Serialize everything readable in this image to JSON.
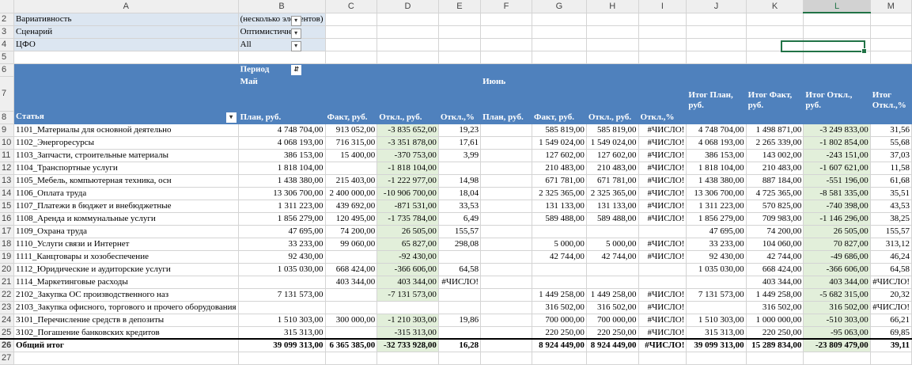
{
  "columns": [
    "A",
    "B",
    "C",
    "D",
    "E",
    "F",
    "G",
    "H",
    "I",
    "J",
    "K",
    "L",
    "M"
  ],
  "selected_column": "L",
  "filters": [
    {
      "row": "2",
      "label": "Вариативность",
      "value": "(несколько элементов)"
    },
    {
      "row": "3",
      "label": "Сценарий",
      "value": "Оптимистичн"
    },
    {
      "row": "4",
      "label": "ЦФО",
      "value": "All"
    }
  ],
  "row5": "5",
  "header": {
    "row6": "6",
    "row7": "7",
    "row8": "8",
    "period_label": "Период",
    "may": "Май",
    "june": "Июнь",
    "total_plan": "Итог План, руб.",
    "total_fact": "Итог Факт, руб.",
    "total_dev": "Итог Откл., руб.",
    "total_dev_pct": "Итог Откл.,%",
    "article": "Статья",
    "plan": "План, руб.",
    "fact": "Факт, руб.",
    "dev": "Откл., руб.",
    "dev_pct": "Откл.,%",
    "plan2": "План, руб.",
    "fact2": "Факт, руб.",
    "dev2": "Откл., руб.",
    "dev_pct2": "Откл.,%"
  },
  "rows": [
    {
      "n": "9",
      "a": "1101_Материалы для основной деятельно",
      "b": "4 748 704,00",
      "c": "913 052,00",
      "d": "-3 835 652,00",
      "e": "19,23",
      "f": "",
      "g": "585 819,00",
      "h": "585 819,00",
      "i": "#ЧИСЛО!",
      "j": "4 748 704,00",
      "k": "1 498 871,00",
      "l": "-3 249 833,00",
      "m": "31,56"
    },
    {
      "n": "10",
      "a": "1102_Энергоресурсы",
      "b": "4 068 193,00",
      "c": "716 315,00",
      "d": "-3 351 878,00",
      "e": "17,61",
      "f": "",
      "g": "1 549 024,00",
      "h": "1 549 024,00",
      "i": "#ЧИСЛО!",
      "j": "4 068 193,00",
      "k": "2 265 339,00",
      "l": "-1 802 854,00",
      "m": "55,68"
    },
    {
      "n": "11",
      "a": "1103_Запчасти, строительные материалы",
      "b": "386 153,00",
      "c": "15 400,00",
      "d": "-370 753,00",
      "e": "3,99",
      "f": "",
      "g": "127 602,00",
      "h": "127 602,00",
      "i": "#ЧИСЛО!",
      "j": "386 153,00",
      "k": "143 002,00",
      "l": "-243 151,00",
      "m": "37,03"
    },
    {
      "n": "12",
      "a": "1104_Транспортные услуги",
      "b": "1 818 104,00",
      "c": "",
      "d": "-1 818 104,00",
      "e": "",
      "f": "",
      "g": "210 483,00",
      "h": "210 483,00",
      "i": "#ЧИСЛО!",
      "j": "1 818 104,00",
      "k": "210 483,00",
      "l": "-1 607 621,00",
      "m": "11,58"
    },
    {
      "n": "13",
      "a": "1105_Мебель, компьютерная техника, осн",
      "b": "1 438 380,00",
      "c": "215 403,00",
      "d": "-1 222 977,00",
      "e": "14,98",
      "f": "",
      "g": "671 781,00",
      "h": "671 781,00",
      "i": "#ЧИСЛО!",
      "j": "1 438 380,00",
      "k": "887 184,00",
      "l": "-551 196,00",
      "m": "61,68"
    },
    {
      "n": "14",
      "a": "1106_Оплата труда",
      "b": "13 306 700,00",
      "c": "2 400 000,00",
      "d": "-10 906 700,00",
      "e": "18,04",
      "f": "",
      "g": "2 325 365,00",
      "h": "2 325 365,00",
      "i": "#ЧИСЛО!",
      "j": "13 306 700,00",
      "k": "4 725 365,00",
      "l": "-8 581 335,00",
      "m": "35,51"
    },
    {
      "n": "15",
      "a": "1107_Платежи в бюджет и внебюджетные",
      "b": "1 311 223,00",
      "c": "439 692,00",
      "d": "-871 531,00",
      "e": "33,53",
      "f": "",
      "g": "131 133,00",
      "h": "131 133,00",
      "i": "#ЧИСЛО!",
      "j": "1 311 223,00",
      "k": "570 825,00",
      "l": "-740 398,00",
      "m": "43,53"
    },
    {
      "n": "16",
      "a": "1108_Аренда и коммунальные услуги",
      "b": "1 856 279,00",
      "c": "120 495,00",
      "d": "-1 735 784,00",
      "e": "6,49",
      "f": "",
      "g": "589 488,00",
      "h": "589 488,00",
      "i": "#ЧИСЛО!",
      "j": "1 856 279,00",
      "k": "709 983,00",
      "l": "-1 146 296,00",
      "m": "38,25"
    },
    {
      "n": "17",
      "a": "1109_Охрана труда",
      "b": "47 695,00",
      "c": "74 200,00",
      "d": "26 505,00",
      "e": "155,57",
      "f": "",
      "g": "",
      "h": "",
      "i": "",
      "j": "47 695,00",
      "k": "74 200,00",
      "l": "26 505,00",
      "m": "155,57"
    },
    {
      "n": "18",
      "a": "1110_Услуги связи и Интернет",
      "b": "33 233,00",
      "c": "99 060,00",
      "d": "65 827,00",
      "e": "298,08",
      "f": "",
      "g": "5 000,00",
      "h": "5 000,00",
      "i": "#ЧИСЛО!",
      "j": "33 233,00",
      "k": "104 060,00",
      "l": "70 827,00",
      "m": "313,12"
    },
    {
      "n": "19",
      "a": "1111_Канцтовары и хозобеспечение",
      "b": "92 430,00",
      "c": "",
      "d": "-92 430,00",
      "e": "",
      "f": "",
      "g": "42 744,00",
      "h": "42 744,00",
      "i": "#ЧИСЛО!",
      "j": "92 430,00",
      "k": "42 744,00",
      "l": "-49 686,00",
      "m": "46,24"
    },
    {
      "n": "20",
      "a": "1112_Юридические и аудиторские услуги",
      "b": "1 035 030,00",
      "c": "668 424,00",
      "d": "-366 606,00",
      "e": "64,58",
      "f": "",
      "g": "",
      "h": "",
      "i": "",
      "j": "1 035 030,00",
      "k": "668 424,00",
      "l": "-366 606,00",
      "m": "64,58"
    },
    {
      "n": "21",
      "a": "1114_Маркетинговые расходы",
      "b": "",
      "c": "403 344,00",
      "d": "403 344,00",
      "e": "#ЧИСЛО!",
      "f": "",
      "g": "",
      "h": "",
      "i": "",
      "j": "",
      "k": "403 344,00",
      "l": "403 344,00",
      "m": "#ЧИСЛО!"
    },
    {
      "n": "22",
      "a": "2102_Закупка ОС производственного наз",
      "b": "7 131 573,00",
      "c": "",
      "d": "-7 131 573,00",
      "e": "",
      "f": "",
      "g": "1 449 258,00",
      "h": "1 449 258,00",
      "i": "#ЧИСЛО!",
      "j": "7 131 573,00",
      "k": "1 449 258,00",
      "l": "-5 682 315,00",
      "m": "20,32"
    },
    {
      "n": "23",
      "a": "2103_Закупка офисного, торгового и прочего оборудования",
      "b": "",
      "c": "",
      "d": "",
      "e": "",
      "f": "",
      "g": "316 502,00",
      "h": "316 502,00",
      "i": "#ЧИСЛО!",
      "j": "",
      "k": "316 502,00",
      "l": "316 502,00",
      "m": "#ЧИСЛО!"
    },
    {
      "n": "24",
      "a": "3101_Перечисление средств в депозиты",
      "b": "1 510 303,00",
      "c": "300 000,00",
      "d": "-1 210 303,00",
      "e": "19,86",
      "f": "",
      "g": "700 000,00",
      "h": "700 000,00",
      "i": "#ЧИСЛО!",
      "j": "1 510 303,00",
      "k": "1 000 000,00",
      "l": "-510 303,00",
      "m": "66,21"
    },
    {
      "n": "25",
      "a": "3102_Погашение банковских кредитов",
      "b": "315 313,00",
      "c": "",
      "d": "-315 313,00",
      "e": "",
      "f": "",
      "g": "220 250,00",
      "h": "220 250,00",
      "i": "#ЧИСЛО!",
      "j": "315 313,00",
      "k": "220 250,00",
      "l": "-95 063,00",
      "m": "69,85"
    }
  ],
  "total": {
    "n": "26",
    "a": "Общий итог",
    "b": "39 099 313,00",
    "c": "6 365 385,00",
    "d": "-32 733 928,00",
    "e": "16,28",
    "f": "",
    "g": "8 924 449,00",
    "h": "8 924 449,00",
    "i": "#ЧИСЛО!",
    "j": "39 099 313,00",
    "k": "15 289 834,00",
    "l": "-23 809 479,00",
    "m": "39,11"
  },
  "row27": "27",
  "colors": {
    "header_blue": "#4f81bd",
    "filter_bg": "#dce6f1",
    "green_bg": "#e2efda",
    "excel_green": "#217346"
  }
}
